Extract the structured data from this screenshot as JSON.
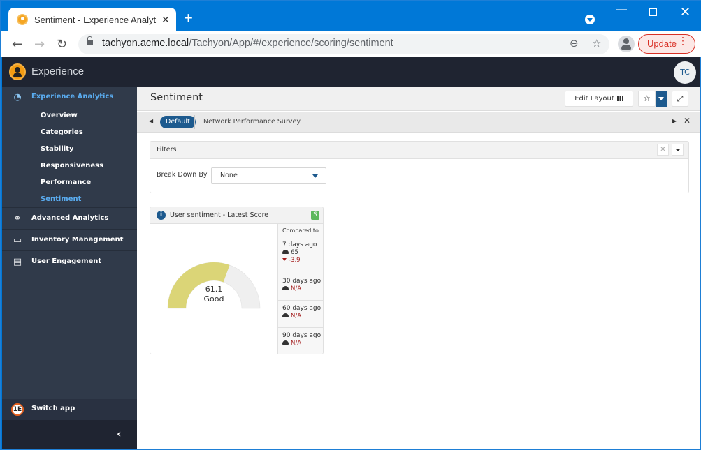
{
  "browser": {
    "tab_title": "Sentiment - Experience Analytics",
    "tab_close": "✕",
    "new_tab": "+",
    "url_host": "tachyon.acme.local",
    "url_path": "/Tachyon/App/#/experience/scoring/sentiment",
    "update_label": "Update",
    "nav": {
      "back": "←",
      "forward": "→",
      "reload": "↻"
    },
    "icons": {
      "zoom": "⊖",
      "star": "☆",
      "menu": "⋮"
    },
    "window": {
      "minimize": "—",
      "close": "✕"
    }
  },
  "app": {
    "title": "Experience",
    "user_initials": "TC"
  },
  "sidebar": {
    "sections": [
      {
        "label": "Experience Analytics",
        "icon": "gauge-icon",
        "glyph": "◔",
        "active": true,
        "items": [
          {
            "label": "Overview"
          },
          {
            "label": "Categories"
          },
          {
            "label": "Stability"
          },
          {
            "label": "Responsiveness"
          },
          {
            "label": "Performance"
          },
          {
            "label": "Sentiment",
            "active": true
          }
        ]
      },
      {
        "label": "Advanced Analytics",
        "icon": "binoculars-icon",
        "glyph": "⚭"
      },
      {
        "label": "Inventory Management",
        "icon": "monitor-icon",
        "glyph": "▭"
      },
      {
        "label": "User Engagement",
        "icon": "clipboard-icon",
        "glyph": "▤"
      }
    ],
    "switch_app": "Switch app",
    "switch_app_glyph": "1E",
    "collapse_glyph": "‹"
  },
  "page": {
    "title": "Sentiment",
    "edit_layout": "Edit Layout",
    "star_glyph": "☆",
    "expand_glyph": "⤢",
    "tabs": {
      "left_arrow": "◀",
      "right_arrow": "▶",
      "close": "✕",
      "items": [
        "Default",
        "Network Performance Survey"
      ]
    }
  },
  "filters": {
    "title": "Filters",
    "clear_glyph": "✕",
    "break_down_label": "Break Down By",
    "break_down_value": "None"
  },
  "card": {
    "title": "User sentiment - Latest Score",
    "info_glyph": "i",
    "badge": "S",
    "score": "61.1",
    "score_label": "Good",
    "score_value": 61.1,
    "score_max": 100,
    "colors": {
      "fill": "#dbd577",
      "track": "#efefef"
    },
    "compared_to": "Compared to",
    "comparisons": [
      {
        "period": "7 days ago",
        "value": "65",
        "delta": "-3.9"
      },
      {
        "period": "30 days ago",
        "value": "N/A"
      },
      {
        "period": "60 days ago",
        "value": "N/A"
      },
      {
        "period": "90 days ago",
        "value": "N/A"
      }
    ]
  }
}
